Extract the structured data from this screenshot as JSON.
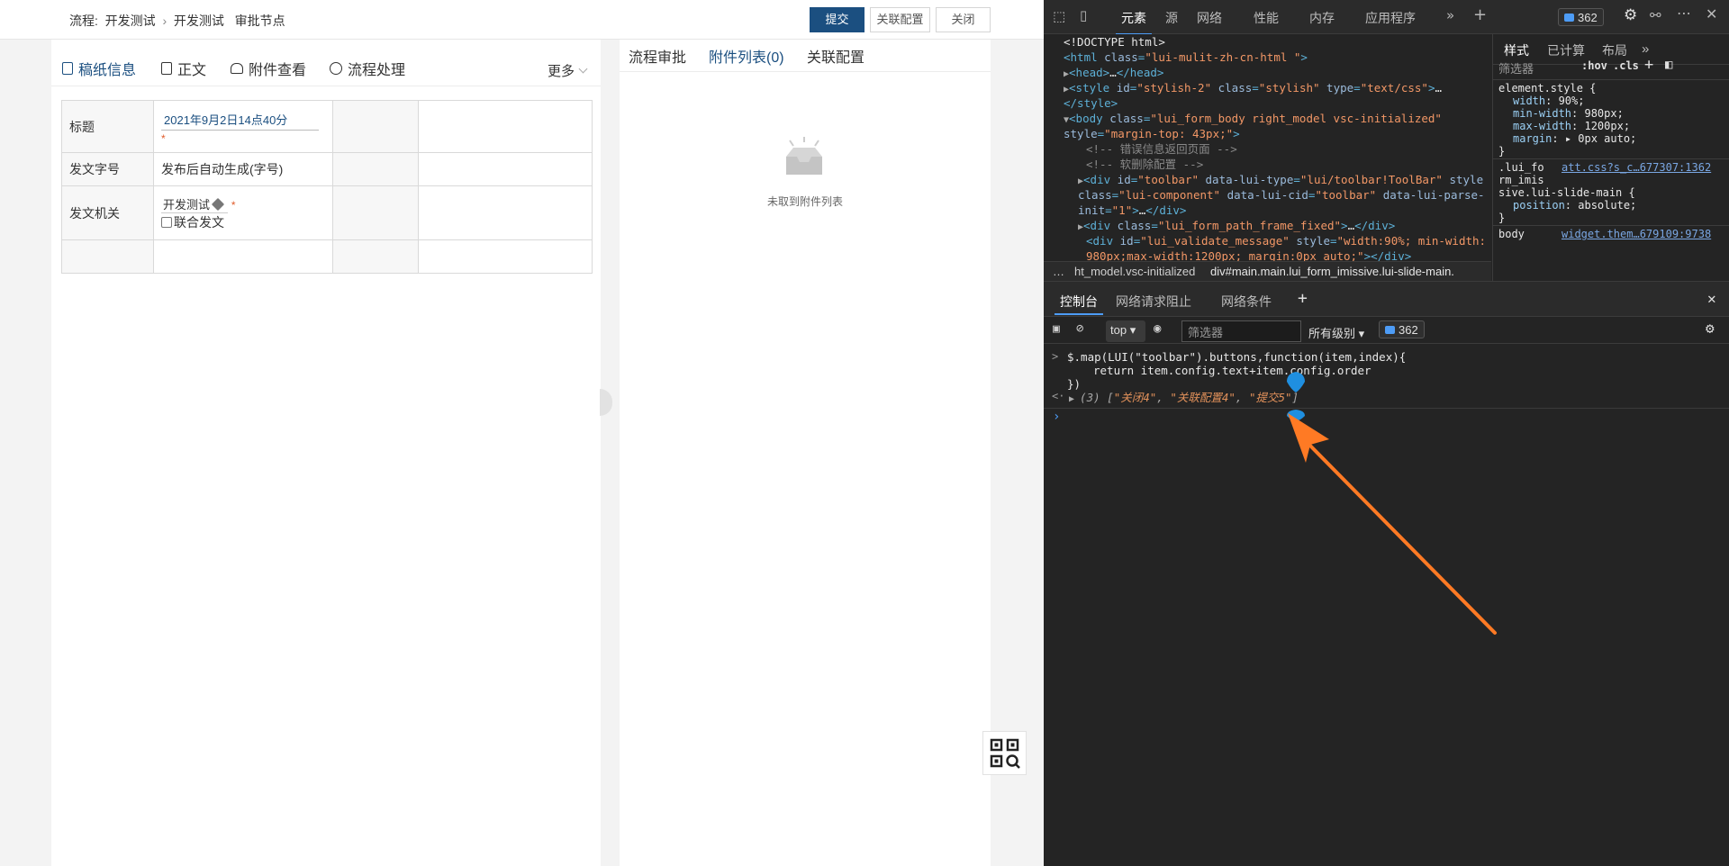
{
  "app": {
    "breadcrumb": {
      "prefix": "流程:",
      "item1": "开发测试",
      "sep": "›",
      "item2": "开发测试",
      "item3": "审批节点"
    },
    "toolbar": {
      "submit": "提交",
      "relation_config": "关联配置",
      "close": "关闭"
    },
    "tabs": [
      {
        "label": "稿纸信息",
        "icon": "document-icon"
      },
      {
        "label": "正文",
        "icon": "page-icon"
      },
      {
        "label": "附件查看",
        "icon": "attachment-icon"
      },
      {
        "label": "流程处理",
        "icon": "flow-icon"
      }
    ],
    "more": "更多",
    "form": {
      "title_label": "标题",
      "title_value": "2021年9月2日14点40分",
      "title_required": "*",
      "doc_number_label": "发文字号",
      "doc_number_value": "发布后自动生成(字号)",
      "org_label": "发文机关",
      "org_value": "开发测试",
      "org_required": "*",
      "joint_label": "联合发文"
    },
    "right_tabs": [
      {
        "label": "流程审批"
      },
      {
        "label": "附件列表(0)"
      },
      {
        "label": "关联配置"
      }
    ],
    "empty_text": "未取到附件列表"
  },
  "devtools": {
    "tabs": [
      "元素",
      "源",
      "网络",
      "性能",
      "内存",
      "应用程序"
    ],
    "issues_count": "362",
    "elements": {
      "lines": [
        {
          "indent": 0,
          "text": "<!DOCTYPE html>"
        },
        {
          "indent": 0,
          "text": "<html class=\"lui-mulit-zh-cn-html \">"
        },
        {
          "indent": 1,
          "text": "<head>…</head>"
        },
        {
          "indent": 1,
          "text": "<style id=\"stylish-2\" class=\"stylish\" type=\"text/css\">…"
        },
        {
          "indent": 0,
          "text": "</style>"
        },
        {
          "indent": 1,
          "text": "<body class=\"lui_form_body right_model vsc-initialized\""
        },
        {
          "indent": 0,
          "text": "style=\"margin-top: 43px;\">"
        },
        {
          "indent": 2,
          "text": "<!-- 错误信息返回页面 -->"
        },
        {
          "indent": 2,
          "text": "<!-- 软删除配置 -->"
        },
        {
          "indent": 2,
          "text": "<div id=\"toolbar\" data-lui-type=\"lui/toolbar!ToolBar\" style"
        },
        {
          "indent": 2,
          "text": "class=\"lui-component\" data-lui-cid=\"toolbar\" data-lui-parse-"
        },
        {
          "indent": 2,
          "text": "init=\"1\">…</div>"
        },
        {
          "indent": 2,
          "text": "<div class=\"lui_form_path_frame_fixed\">…</div>"
        },
        {
          "indent": 2,
          "text": "<div id=\"lui_validate_message\" style=\"width:90%; min-width:"
        },
        {
          "indent": 2,
          "text": "980px;max-width:1200px; margin:0px auto;\"></div>"
        }
      ],
      "breadcrumb": [
        "…",
        "ht_model.vsc-initialized",
        "div#main.main.lui_form_imissive.lui-slide-main."
      ]
    },
    "styles": {
      "tabs": [
        "样式",
        "已计算",
        "布局"
      ],
      "filter_placeholder": "筛选器",
      "hov": ":hov",
      "cls": ".cls",
      "rule1_selector": "element.style {",
      "rule1_props": [
        {
          "prop": "width",
          "val": "90%;"
        },
        {
          "prop": "min-width",
          "val": "980px;"
        },
        {
          "prop": "max-width",
          "val": "1200px;"
        },
        {
          "prop": "margin",
          "val": "▸ 0px auto;"
        }
      ],
      "rule2_selector_a": ".lui_fo",
      "rule2_link": "att.css?s_c…677307:1362",
      "rule2_selector_b": "rm_imis",
      "rule2_selector_c": "sive.lui-slide-main {",
      "rule2_prop": "position",
      "rule2_val": "absolute;",
      "rule3_selector": "body",
      "rule3_link": "widget.them…679109:9738"
    },
    "console": {
      "tabs": [
        "控制台",
        "网络请求阻止",
        "网络条件"
      ],
      "context": "top",
      "filter_placeholder": "筛选器",
      "levels": "所有级别",
      "issues_count": "362",
      "input_line1": "$.map(LUI(\"toolbar\").buttons,function(item,index){",
      "input_line2": "return item.config.text+item.config.order",
      "input_line3": "})",
      "result_prefix": "(3) [",
      "result_items": [
        "\"关闭4\"",
        "\"关联配置4\"",
        "\"提交5\""
      ],
      "result_suffix": "]"
    }
  }
}
